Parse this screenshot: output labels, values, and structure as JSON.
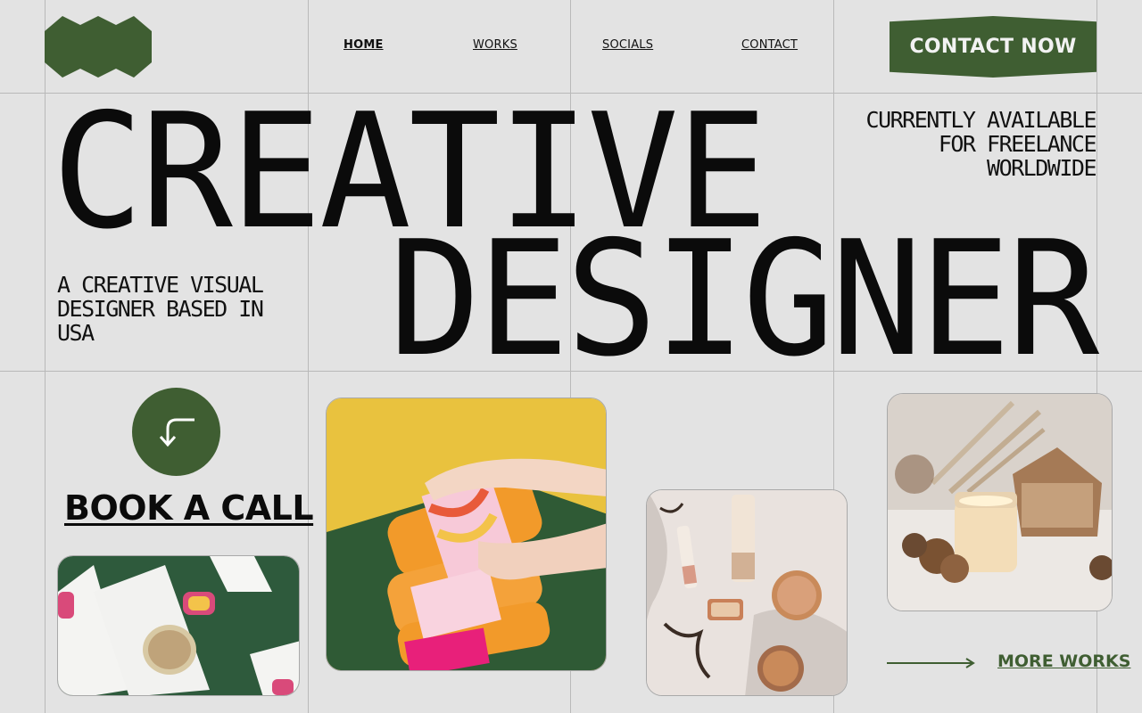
{
  "nav": {
    "items": [
      {
        "label": "HOME",
        "active": true
      },
      {
        "label": "WORKS",
        "active": false
      },
      {
        "label": "SOCIALS",
        "active": false
      },
      {
        "label": "CONTACT",
        "active": false
      }
    ],
    "cta_label": "CONTACT NOW"
  },
  "hero": {
    "line1": "CREATIVE",
    "line2": "DESIGNER",
    "availability": [
      "CURRENTLY AVAILABLE",
      "FOR FREELANCE",
      "WORLDWIDE"
    ],
    "tagline": "A CREATIVE VISUAL DESIGNER BASED IN USA"
  },
  "book_call_label": "BOOK A CALL",
  "more_works_label": "MORE WORKS",
  "icons": {
    "logo": "hexagon-chain-logo",
    "arrow": "arrow-turn-left-icon",
    "more": "long-arrow-right-icon"
  },
  "colors": {
    "accent": "#3f5e32",
    "background": "#e3e3e3",
    "text": "#0b0b0b"
  }
}
